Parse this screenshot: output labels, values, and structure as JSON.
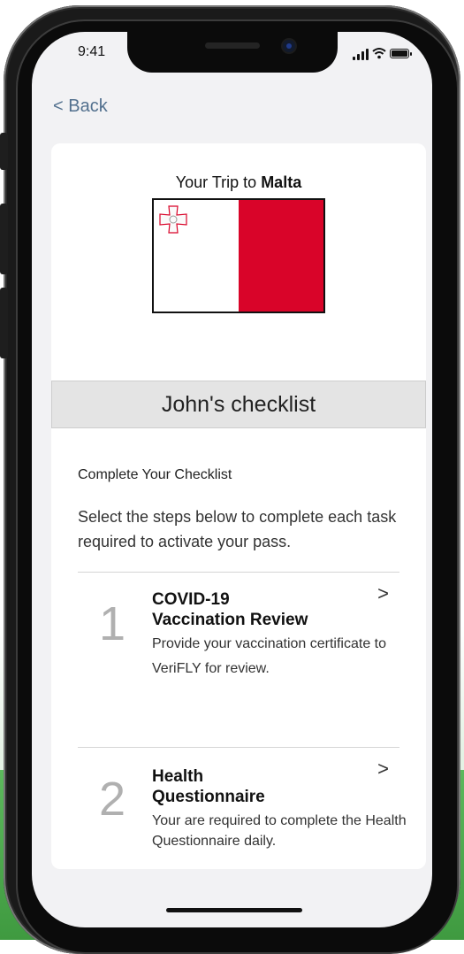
{
  "status": {
    "time": "9:41"
  },
  "nav": {
    "back_label": "< Back"
  },
  "trip": {
    "prefix": "Your Trip to ",
    "destination": "Malta"
  },
  "checklist_banner": "John's checklist",
  "section": {
    "heading": "Complete Your Checklist",
    "description": "Select the steps below to complete each task required to activate your pass."
  },
  "steps": [
    {
      "number": "1",
      "title_line1": "COVID-19",
      "title_line2": "Vaccination Review",
      "description": "Provide your vaccination certificate to VeriFLY for review.",
      "chevron": ">"
    },
    {
      "number": "2",
      "title_line1": "Health",
      "title_line2": "Questionnaire",
      "description": "Your are required to complete the Health Questionnaire daily.",
      "chevron": ">"
    }
  ],
  "icons": [
    "signal-icon",
    "wifi-icon",
    "battery-icon",
    "chevron-right-icon",
    "malta-flag"
  ],
  "colors": {
    "back_link": "#52708e",
    "flag_red": "#d90429",
    "step_number": "#b0b0b0",
    "background_green": "#4aa84a"
  }
}
